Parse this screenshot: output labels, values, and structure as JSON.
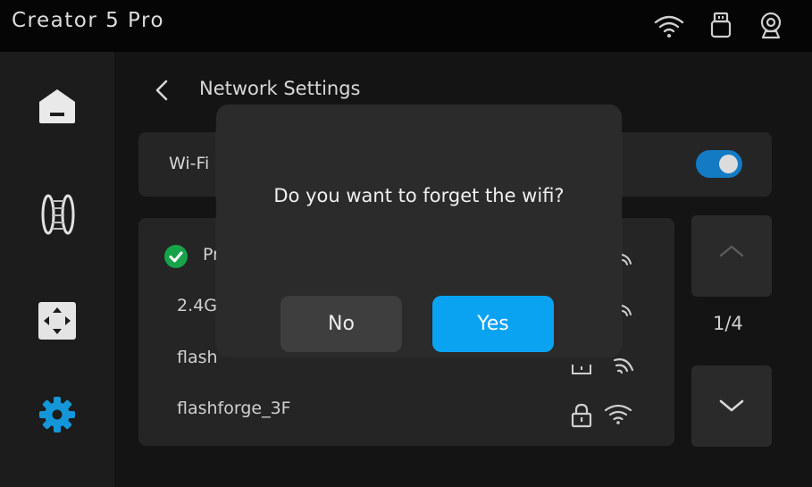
{
  "app": {
    "title": "Creator 5 Pro"
  },
  "topbar_icons": [
    "wifi-icon",
    "usb-icon",
    "webcam-icon"
  ],
  "sidebar": {
    "items": [
      {
        "name": "home",
        "icon": "home-icon",
        "active": false
      },
      {
        "name": "filament",
        "icon": "filament-spool-icon",
        "active": false
      },
      {
        "name": "move",
        "icon": "move-axes-icon",
        "active": false
      },
      {
        "name": "settings",
        "icon": "gear-icon",
        "active": true
      }
    ]
  },
  "screen": {
    "title": "Network Settings"
  },
  "wifi_toggle": {
    "label": "Wi-Fi",
    "enabled": true
  },
  "networks": [
    {
      "name": "Pr",
      "connected": true,
      "locked": false
    },
    {
      "name": "2.4G",
      "connected": false,
      "locked": false
    },
    {
      "name": "flash",
      "connected": false,
      "locked": true
    },
    {
      "name": "flashforge_3F",
      "connected": false,
      "locked": true
    }
  ],
  "pagination": {
    "page": "1/4"
  },
  "dialog": {
    "message": "Do you want to forget the wifi?",
    "no_label": "No",
    "yes_label": "Yes"
  },
  "colors": {
    "accent": "#0aa3f2",
    "toggle_on": "#137ac4",
    "connected": "#17a34a",
    "settings_active": "#1497d8"
  }
}
